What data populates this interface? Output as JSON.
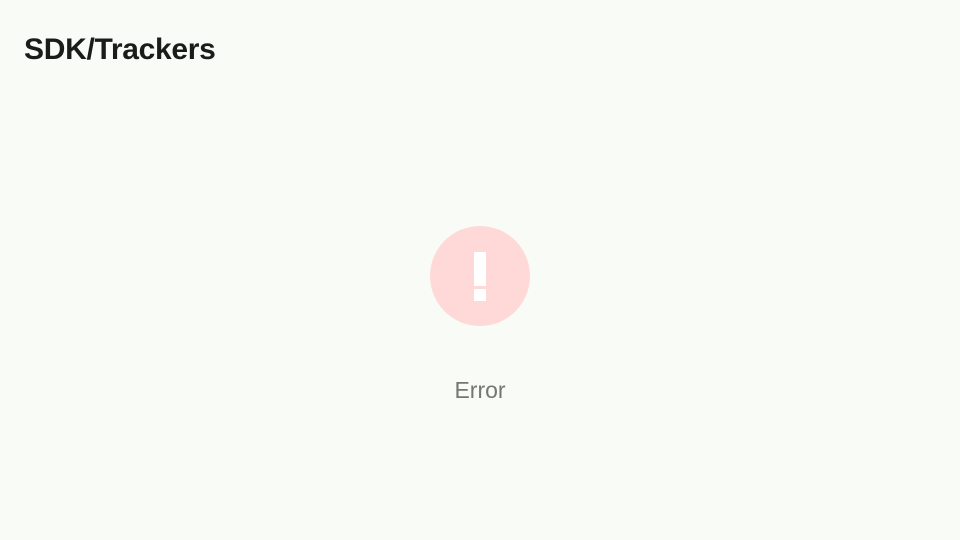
{
  "header": {
    "title": "SDK/Trackers"
  },
  "error_state": {
    "icon": "error-icon",
    "label": "Error",
    "colors": {
      "icon_background": "#ffd9d7",
      "icon_glyph": "#ffffff",
      "label": "#717970"
    }
  },
  "colors": {
    "background": "#f9fbf7",
    "title": "#1b1c1a"
  }
}
